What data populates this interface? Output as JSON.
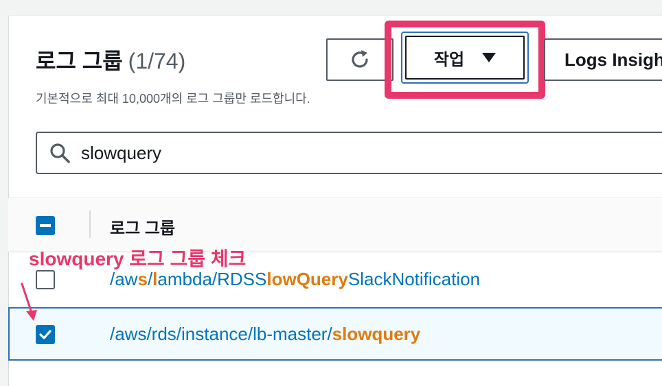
{
  "header": {
    "title": "로그 그룹",
    "count": "(1/74)",
    "subtitle": "기본적으로 최대 10,000개의 로그 그룹만 로드합니다."
  },
  "toolbar": {
    "refresh_icon": "refresh-icon",
    "actions_label": "작업",
    "insights_label": "Logs Insigh"
  },
  "search": {
    "icon": "search-icon",
    "value": "slowquery"
  },
  "table": {
    "column_header": "로그 그룹",
    "rows": [
      {
        "checked": false,
        "segments": [
          "/aw",
          "s",
          "/",
          "l",
          "ambda/RDSS",
          "lowQuery",
          "SlackNotification"
        ]
      },
      {
        "checked": true,
        "segments": [
          "/aws/rds/instance/lb-master/",
          "slowquery"
        ]
      }
    ]
  },
  "annotation": {
    "text": "slowquery 로그 그룹 체크",
    "color": "#e8376a"
  },
  "colors": {
    "link": "#0073bb",
    "match_highlight": "#e07b0e",
    "checkbox": "#0073bb",
    "callout": "#e8376a"
  }
}
